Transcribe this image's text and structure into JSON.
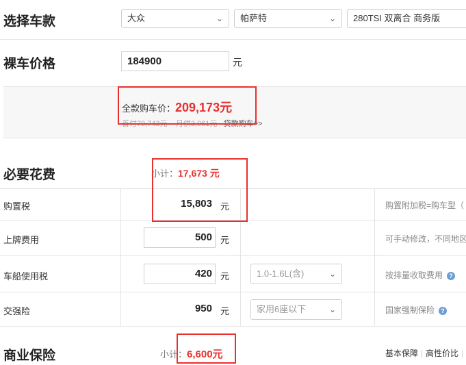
{
  "model_selection": {
    "title": "选择车款",
    "brand": "大众",
    "series": "帕萨特",
    "trim": "280TSI 双离合 商务版"
  },
  "bare_price": {
    "title": "裸车价格",
    "value": "184900",
    "unit": "元"
  },
  "summary": {
    "full_price_label": "全款购车价：",
    "full_price_value": "209,173元",
    "down_payment": "首付79,743元",
    "monthly": "月供3,961元",
    "loan_link": "贷款购车>>"
  },
  "required_costs": {
    "title": "必要花费",
    "subtotal_label": "小计：",
    "subtotal_value": "17,673 元",
    "rows": [
      {
        "label": "购置税",
        "value": "15,803",
        "unit": "元",
        "note": "购置附加税=购车型（"
      },
      {
        "label": "上牌费用",
        "value": "500",
        "unit": "元",
        "note": "可手动修改，不同地区"
      },
      {
        "label": "车船使用税",
        "value": "420",
        "unit": "元",
        "option": "1.0-1.6L(含)",
        "note": "按排量收取费用"
      },
      {
        "label": "交强险",
        "value": "950",
        "unit": "元",
        "option": "家用6座以下",
        "note": "国家强制保险"
      }
    ]
  },
  "commercial_insurance": {
    "title": "商业保险",
    "subtotal_label": "小计：",
    "subtotal_value": "6,600元",
    "link_basic": "基本保障",
    "link_value": "高性价比"
  },
  "colors": {
    "accent_red": "#e8312f",
    "help_icon_blue": "#6a9fd6"
  },
  "icons": {
    "dropdown": "chevron-down-icon",
    "help": "question-icon"
  }
}
